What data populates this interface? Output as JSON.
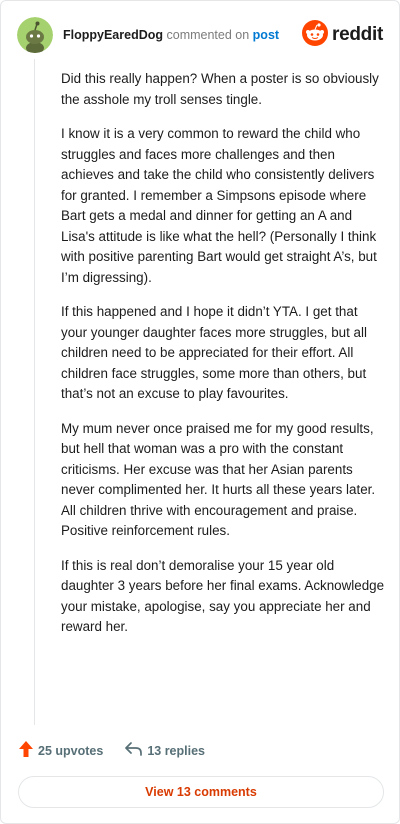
{
  "header": {
    "username": "FloppyEaredDog",
    "verb": "commented on",
    "link": "post",
    "brand": "reddit"
  },
  "comment": {
    "paragraphs": [
      "Did this really happen? When a poster is so obviously the asshole my troll senses tingle.",
      "I know it is a very common to reward the child who struggles and faces more challenges and then achieves and take the child who consistently delivers for granted. I remember a Simpsons episode where Bart gets a medal and dinner for getting an A and Lisa's attitude is like what the hell? (Personally I think with positive parenting Bart would get straight A’s, but I’m digressing).",
      "If this happened and I hope it didn’t YTA. I get that your younger daughter faces more struggles, but all children need to be appreciated for their effort. All children face struggles, some more than others, but that’s not an excuse to play favourites.",
      "My mum never once praised me for my good results, but hell that woman was a pro with the constant criticisms. Her excuse was that her Asian parents never complimented her. It hurts all these years later. All children thrive with encouragement and praise. Positive reinforcement rules.",
      "If this is real don’t demoralise your 15 year old daughter 3 years before her final exams. Acknowledge your mistake, apologise, say you appreciate her and reward her."
    ]
  },
  "actions": {
    "upvotes": "25 upvotes",
    "replies": "13 replies",
    "view_comments": "View 13 comments"
  },
  "colors": {
    "upvote": "#ff4500",
    "link": "#0079d3",
    "view_button_text": "#d93a00",
    "avatar_bg": "#a5d26e"
  },
  "icons": {
    "avatar": "snoo-avatar",
    "brand": "reddit-logo-icon",
    "upvote": "upvote-arrow-icon",
    "reply": "reply-arrow-icon"
  }
}
